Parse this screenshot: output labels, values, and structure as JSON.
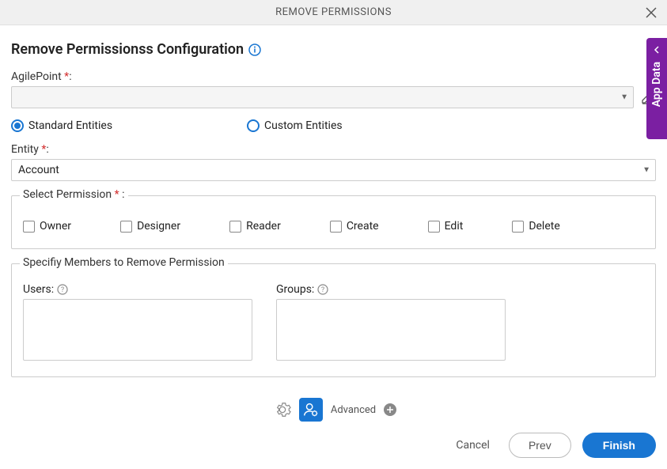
{
  "header": {
    "title": "REMOVE PERMISSIONS"
  },
  "page_title": "Remove Permissionss Configuration",
  "fields": {
    "agilepoint": {
      "label": "AgilePoint",
      "value": ""
    },
    "entity_type": {
      "standard_label": "Standard Entities",
      "custom_label": "Custom Entities",
      "selected": "standard"
    },
    "entity": {
      "label": "Entity",
      "value": "Account"
    }
  },
  "permissions": {
    "legend": "Select Permission",
    "options": [
      "Owner",
      "Designer",
      "Reader",
      "Create",
      "Edit",
      "Delete"
    ]
  },
  "members": {
    "legend": "Specifiy Members to Remove Permission",
    "users_label": "Users:",
    "groups_label": "Groups:"
  },
  "side_tab": {
    "label": "App Data"
  },
  "bottom": {
    "advanced_label": "Advanced"
  },
  "buttons": {
    "cancel": "Cancel",
    "prev": "Prev",
    "finish": "Finish"
  },
  "colors": {
    "accent": "#1976d2",
    "purple": "#7b1fa2",
    "required": "#d32f2f"
  }
}
